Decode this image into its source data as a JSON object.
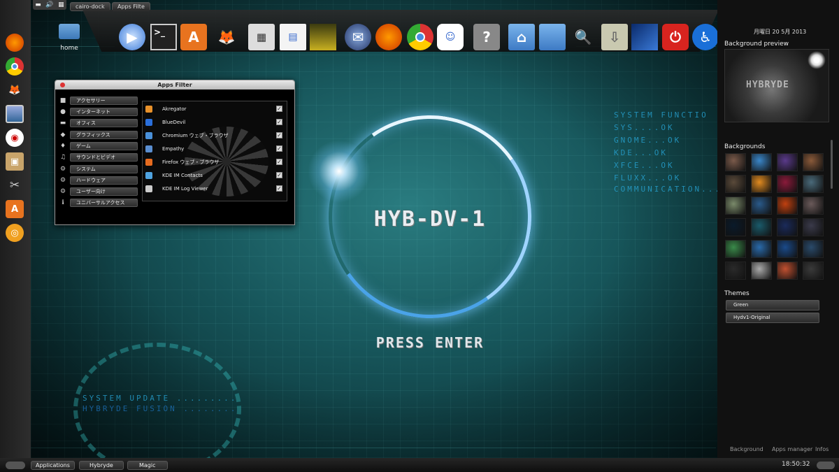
{
  "top_bar": {
    "tabs": [
      "cairo-dock",
      "Apps Filte"
    ]
  },
  "desktop": {
    "home_label": "home",
    "logo": "HYB-DV-1",
    "prompt": "PRESS ENTER",
    "tech_right": [
      "SYSTEM   FUNCTIO",
      "SYS....OK",
      "GNOME...OK",
      "KDE...OK",
      "XFCE...OK",
      "FLUXX...OK",
      "COMMUNICATION..."
    ],
    "tech_bottom": [
      "SYSTEM   UPDATE  .........",
      "HYBRYDE   FUSION  ........"
    ]
  },
  "dock_icons": [
    "video-player-icon",
    "terminal-icon",
    "software-center-icon",
    "gimp-icon",
    "calculator-icon",
    "document-viewer-icon",
    "image-viewer-icon",
    "thunderbird-icon",
    "firefox-icon",
    "chromium-icon",
    "chat-icon",
    "help-icon",
    "home-folder-icon",
    "folder-icon",
    "search-icon",
    "downloads-icon",
    "display-icon",
    "power-icon",
    "accessibility-icon"
  ],
  "left_dock_icons": [
    "firefox-icon",
    "chromium-icon",
    "gimp-icon",
    "display-icon",
    "app-icon",
    "archive-icon",
    "tools-icon",
    "software-center-icon",
    "disc-icon"
  ],
  "apps_window": {
    "title": "Apps Filter",
    "categories": [
      {
        "icon": "■",
        "label": "アクセサリー"
      },
      {
        "icon": "●",
        "label": "インターネット"
      },
      {
        "icon": "▬",
        "label": "オフィス"
      },
      {
        "icon": "◆",
        "label": "グラフィックス"
      },
      {
        "icon": "♦",
        "label": "ゲーム"
      },
      {
        "icon": "♫",
        "label": "サウンドとビデオ"
      },
      {
        "icon": "⚙",
        "label": "システム"
      },
      {
        "icon": "⚙",
        "label": "ハードウェア"
      },
      {
        "icon": "⚙",
        "label": "ユーザー向け"
      },
      {
        "icon": "ℹ",
        "label": "ユニバーサルアクセス"
      }
    ],
    "apps": [
      {
        "label": "Akregator",
        "color": "#e8912a",
        "checked": "✓"
      },
      {
        "label": "BlueDevil",
        "color": "#2a6fdb",
        "checked": "✓"
      },
      {
        "label": "Chromium ウェブ・ブラウザ",
        "color": "#4a90d9",
        "checked": "✓"
      },
      {
        "label": "Empathy",
        "color": "#5a8ed0",
        "checked": "✓"
      },
      {
        "label": "Firefox ウェブ・ブラウザ",
        "color": "#e66b1f",
        "checked": "✓"
      },
      {
        "label": "KDE IM Contacts",
        "color": "#4fa3e0",
        "checked": "✓"
      },
      {
        "label": "KDE IM Log Viewer",
        "color": "#cccccc",
        "checked": "✓"
      }
    ]
  },
  "right_panel": {
    "date": "月曜日 20 5月 2013",
    "preview_title": "Background preview",
    "preview_logo": "HYBRYDE",
    "backgrounds_title": "Backgrounds",
    "thumb_colors": [
      "#7a5a4a",
      "#3a86c8",
      "#5a3a8a",
      "#8a5a3a",
      "#5a4a3a",
      "#e08a20",
      "#8a1a3a",
      "#4a6a7a",
      "#7a8a6a",
      "#2a5a8a",
      "#c04010",
      "#6a5a5a",
      "#0a1a2a",
      "#1a5a6a",
      "#1a2a5a",
      "#3a3a4a",
      "#3a8a4a",
      "#2a6aaa",
      "#1a4a8a",
      "#2a4a6a",
      "#2a2a2a",
      "#aaaaaa",
      "#c05030",
      "#3a3a3a"
    ],
    "themes_title": "Themes",
    "themes": [
      "Green",
      "Hydv1-Original"
    ],
    "footer_links": [
      "Background",
      "Apps manager",
      "Infos"
    ]
  },
  "bottom_panel": {
    "buttons": [
      "Applications",
      "Hybryde",
      "Magic"
    ],
    "clock": "18:50:32"
  }
}
